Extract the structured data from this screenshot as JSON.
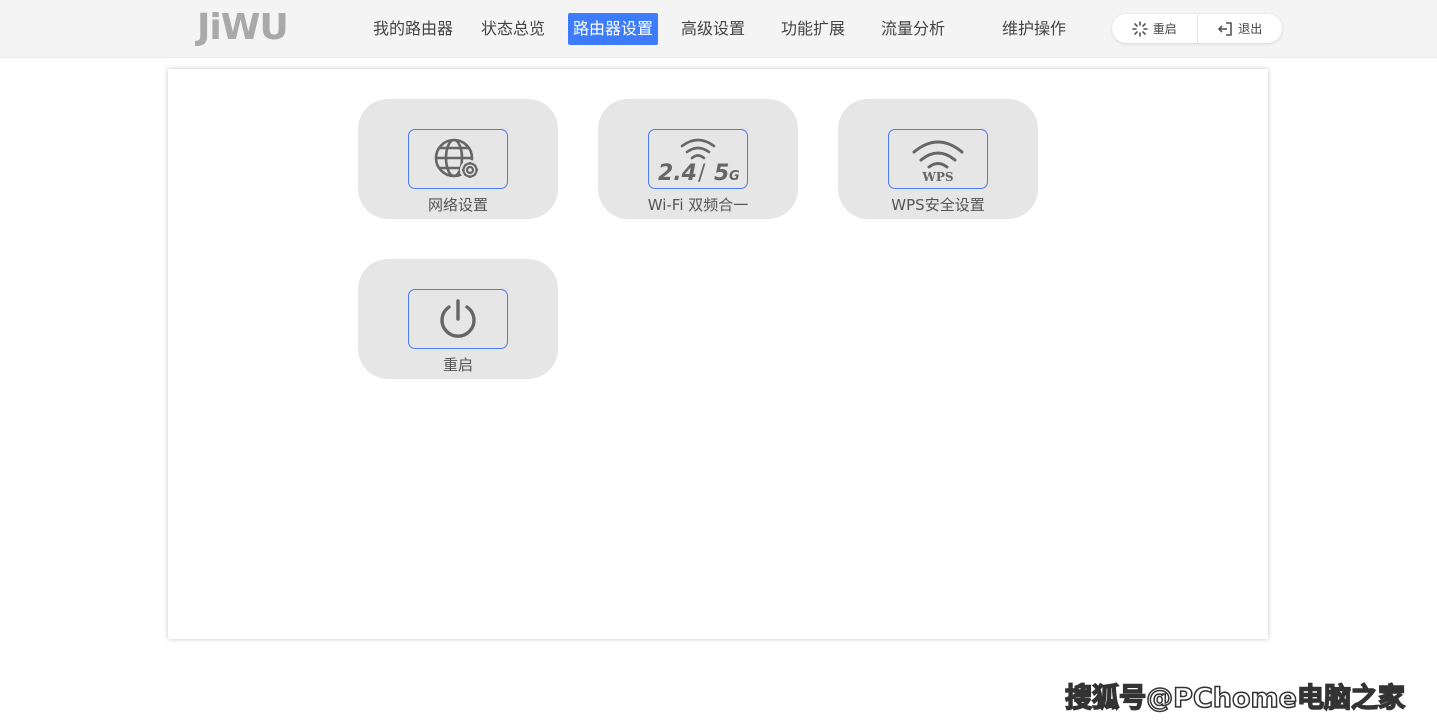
{
  "brand": {
    "logo_text": "JiWU"
  },
  "nav": {
    "items": [
      {
        "label": "我的路由器"
      },
      {
        "label": "状态总览"
      },
      {
        "label": "路由器设置",
        "active": true
      },
      {
        "label": "高级设置"
      },
      {
        "label": "功能扩展"
      },
      {
        "label": "流量分析"
      },
      {
        "label": "维护操作"
      }
    ]
  },
  "actions": {
    "reboot_label": "重启",
    "logout_label": "退出"
  },
  "tiles": [
    {
      "label": "网络设置",
      "icon": "globe-gear-icon"
    },
    {
      "label": "Wi-Fi 双频合一",
      "icon": "wifi-dual-band-icon",
      "icon_text_a": "2.4",
      "icon_text_sep": "/",
      "icon_text_b": "5",
      "icon_text_c": "G"
    },
    {
      "label": "WPS安全设置",
      "icon": "wps-icon",
      "icon_text": "WPS"
    },
    {
      "label": "重启",
      "icon": "power-icon"
    }
  ],
  "watermark": "搜狐号@PChome电脑之家",
  "colors": {
    "accent": "#3d7bff",
    "tile_bg": "#e6e6e6",
    "icon_border": "#4a7ef0",
    "icon_gray": "#666666"
  }
}
